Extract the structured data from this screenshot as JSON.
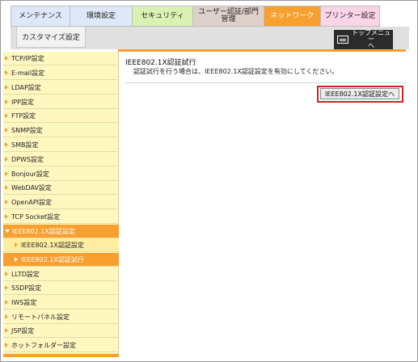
{
  "tabs": [
    {
      "label": "メンテナンス"
    },
    {
      "label": "環境設定"
    },
    {
      "label": "セキュリティ"
    },
    {
      "label": "ユーザー認証/部門\n管理"
    },
    {
      "label": "ネットワーク"
    },
    {
      "label": "プリンター設定"
    }
  ],
  "subtab": {
    "label": "カスタマイズ設定"
  },
  "topmenu": {
    "label": "トップメニュー\nへ"
  },
  "sidebar": {
    "items": [
      {
        "label": "TCP/IP設定"
      },
      {
        "label": "E-mail設定"
      },
      {
        "label": "LDAP設定"
      },
      {
        "label": "IPP設定"
      },
      {
        "label": "FTP設定"
      },
      {
        "label": "SNMP設定"
      },
      {
        "label": "SMB設定"
      },
      {
        "label": "DPWS設定"
      },
      {
        "label": "Bonjour設定"
      },
      {
        "label": "WebDAV設定"
      },
      {
        "label": "OpenAPI設定"
      },
      {
        "label": "TCP Socket設定"
      },
      {
        "label": "IEEE802.1X認証設定"
      },
      {
        "label": "IEEE802.1X認証設定"
      },
      {
        "label": "IEEE802.1X認証試行"
      },
      {
        "label": "LLTD設定"
      },
      {
        "label": "SSDP設定"
      },
      {
        "label": "IWS設定"
      },
      {
        "label": "リモートパネル設定"
      },
      {
        "label": "JSP設定"
      },
      {
        "label": "ホットフォルダー設定"
      }
    ]
  },
  "main": {
    "title": "IEEE802.1X認証試行",
    "description": "認証試行を行う場合は、IEEE802.1X認証設定を有効にしてください。",
    "button_label": "IEEE802.1X認証設定へ"
  },
  "colors": {
    "accent": "#f7a02f",
    "sidebar_bg": "#fff7c0",
    "highlight": "#d62020"
  }
}
